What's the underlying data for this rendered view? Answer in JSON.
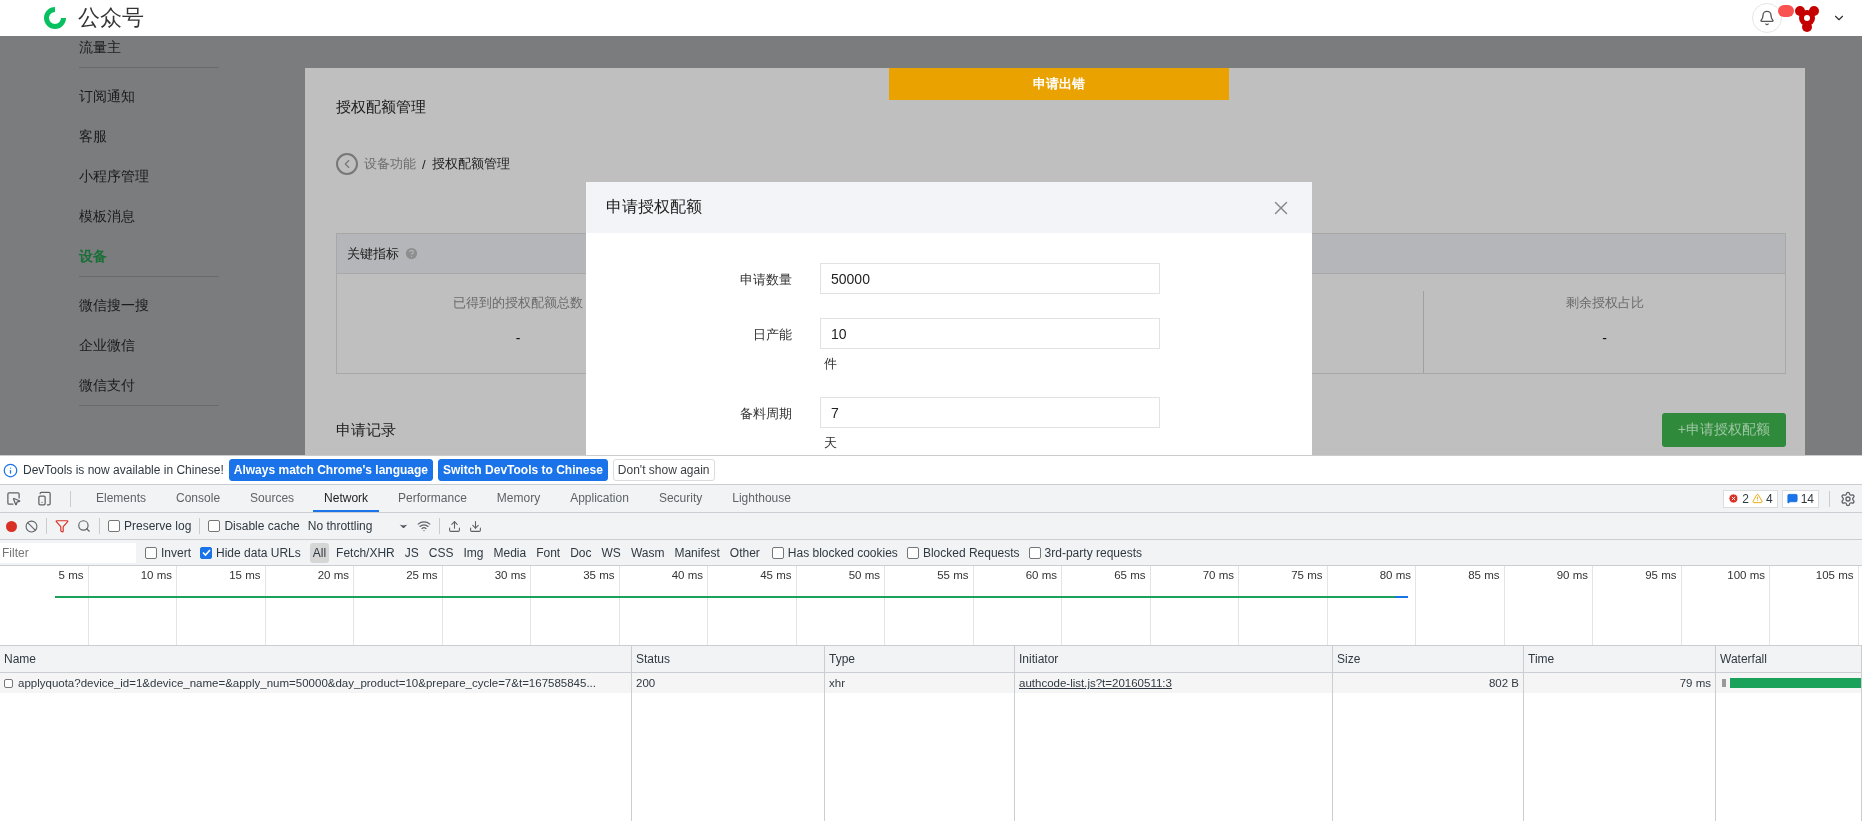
{
  "header": {
    "brand": "公众号",
    "notification_badge": true
  },
  "sidebar": {
    "groups": [
      {
        "items": [
          {
            "label": "流量主",
            "selected": false
          }
        ]
      },
      {
        "items": [
          {
            "label": "订阅通知",
            "selected": false
          },
          {
            "label": "客服",
            "selected": false
          },
          {
            "label": "小程序管理",
            "selected": false
          },
          {
            "label": "模板消息",
            "selected": false
          },
          {
            "label": "设备",
            "selected": true
          }
        ]
      },
      {
        "items": [
          {
            "label": "微信搜一搜",
            "selected": false
          },
          {
            "label": "企业微信",
            "selected": false
          },
          {
            "label": "微信支付",
            "selected": false
          }
        ]
      }
    ]
  },
  "error_banner": "申请出错",
  "content": {
    "title": "授权配额管理",
    "breadcrumb": {
      "parent": "设备功能",
      "separator": "/",
      "current": "授权配额管理"
    },
    "metrics": {
      "title": "关键指标",
      "columns": [
        {
          "label": "已得到的授权配额总数",
          "value": "-"
        },
        {
          "label": "剩余授权占比",
          "value": "-"
        }
      ]
    },
    "records_title": "申请记录",
    "apply_button": "+申请授权配额"
  },
  "dialog": {
    "title": "申请授权配额",
    "fields": [
      {
        "label": "申请数量",
        "value": "50000"
      },
      {
        "label": "日产能",
        "value": "10",
        "unit": "件"
      },
      {
        "label": "备料周期",
        "value": "7",
        "unit": "天"
      }
    ]
  },
  "devtools": {
    "infobar": {
      "message": "DevTools is now available in Chinese!",
      "buttons": [
        {
          "label": "Always match Chrome's language",
          "kind": "primary"
        },
        {
          "label": "Switch DevTools to Chinese",
          "kind": "primary"
        },
        {
          "label": "Don't show again",
          "kind": "plain"
        }
      ]
    },
    "tabs": [
      {
        "label": "Elements",
        "selected": false
      },
      {
        "label": "Console",
        "selected": false
      },
      {
        "label": "Sources",
        "selected": false
      },
      {
        "label": "Network",
        "selected": true
      },
      {
        "label": "Performance",
        "selected": false
      },
      {
        "label": "Memory",
        "selected": false
      },
      {
        "label": "Application",
        "selected": false
      },
      {
        "label": "Security",
        "selected": false
      },
      {
        "label": "Lighthouse",
        "selected": false
      }
    ],
    "counters": {
      "errors": "2",
      "warnings": "4",
      "messages": "14"
    },
    "toolbar": {
      "recording": true,
      "preserve_log": {
        "label": "Preserve log",
        "checked": false
      },
      "disable_cache": {
        "label": "Disable cache",
        "checked": false
      },
      "throttling": "No throttling"
    },
    "filter": {
      "placeholder": "Filter",
      "checks": [
        {
          "label": "Invert",
          "checked": false
        },
        {
          "label": "Hide data URLs",
          "checked": true
        }
      ],
      "types": [
        {
          "label": "All",
          "selected": true
        },
        {
          "label": "Fetch/XHR",
          "selected": false
        },
        {
          "label": "JS",
          "selected": false
        },
        {
          "label": "CSS",
          "selected": false
        },
        {
          "label": "Img",
          "selected": false
        },
        {
          "label": "Media",
          "selected": false
        },
        {
          "label": "Font",
          "selected": false
        },
        {
          "label": "Doc",
          "selected": false
        },
        {
          "label": "WS",
          "selected": false
        },
        {
          "label": "Wasm",
          "selected": false
        },
        {
          "label": "Manifest",
          "selected": false
        },
        {
          "label": "Other",
          "selected": false
        }
      ],
      "more_checks": [
        {
          "label": "Has blocked cookies",
          "checked": false
        },
        {
          "label": "Blocked Requests",
          "checked": false
        },
        {
          "label": "3rd-party requests",
          "checked": false
        }
      ]
    },
    "timeline_ticks": [
      "5 ms",
      "10 ms",
      "15 ms",
      "20 ms",
      "25 ms",
      "30 ms",
      "35 ms",
      "40 ms",
      "45 ms",
      "50 ms",
      "55 ms",
      "60 ms",
      "65 ms",
      "70 ms",
      "75 ms",
      "80 ms",
      "85 ms",
      "90 ms",
      "95 ms",
      "100 ms",
      "105 ms"
    ],
    "table": {
      "columns": [
        "Name",
        "Status",
        "Type",
        "Initiator",
        "Size",
        "Time",
        "Waterfall"
      ],
      "rows": [
        {
          "name": "applyquota?device_id=1&device_name=&apply_num=50000&day_product=10&prepare_cycle=7&t=167585845...",
          "status": "200",
          "type": "xhr",
          "initiator": "authcode-list.js?t=20160511:3",
          "size": "802 B",
          "time": "79 ms"
        }
      ]
    }
  }
}
